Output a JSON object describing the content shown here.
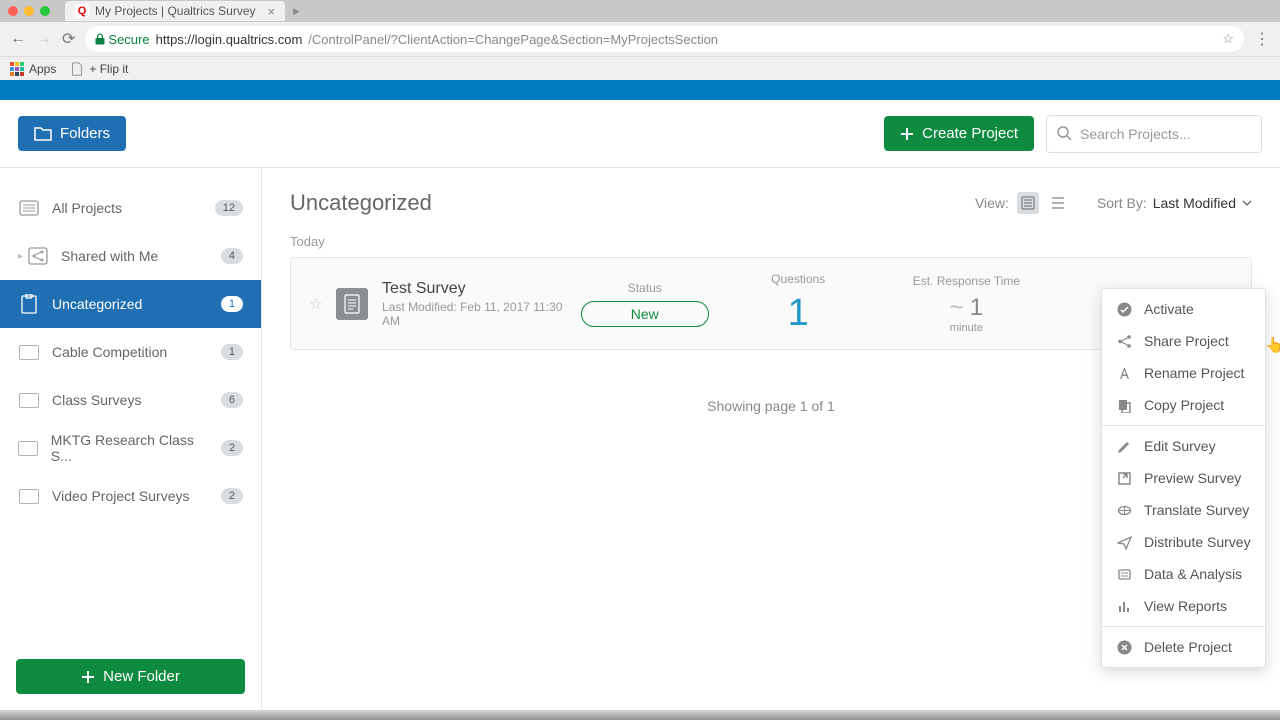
{
  "browser": {
    "tab_title": "My Projects | Qualtrics Survey",
    "secure_label": "Secure",
    "url_host": "https://login.qualtrics.com",
    "url_path": "/ControlPanel/?ClientAction=ChangePage&Section=MyProjectsSection",
    "apps_label": "Apps",
    "bookmark1": "+ Flip it"
  },
  "toolbar": {
    "folders_label": "Folders",
    "create_label": "Create Project",
    "search_placeholder": "Search Projects..."
  },
  "sidebar": {
    "items": [
      {
        "label": "All Projects",
        "count": "12"
      },
      {
        "label": "Shared with Me",
        "count": "4"
      },
      {
        "label": "Uncategorized",
        "count": "1"
      },
      {
        "label": "Cable Competition",
        "count": "1"
      },
      {
        "label": "Class Surveys",
        "count": "6"
      },
      {
        "label": "MKTG Research Class S...",
        "count": "2"
      },
      {
        "label": "Video Project Surveys",
        "count": "2"
      }
    ],
    "new_folder_label": "New Folder"
  },
  "content": {
    "title": "Uncategorized",
    "view_label": "View:",
    "sort_label": "Sort By:",
    "sort_value": "Last Modified",
    "group_label": "Today",
    "paging": "Showing page 1 of 1"
  },
  "project": {
    "name": "Test Survey",
    "modified": "Last Modified: Feb 11, 2017 11:30 AM",
    "status_label": "Status",
    "status_value": "New",
    "questions_label": "Questions",
    "questions_value": "1",
    "est_label": "Est. Response Time",
    "est_tilde": "~",
    "est_value": "1",
    "est_unit": "minute"
  },
  "menu": {
    "activate": "Activate",
    "share": "Share Project",
    "rename": "Rename Project",
    "copy": "Copy Project",
    "edit": "Edit Survey",
    "preview": "Preview Survey",
    "translate": "Translate Survey",
    "distribute": "Distribute Survey",
    "data": "Data & Analysis",
    "reports": "View Reports",
    "delete": "Delete Project"
  }
}
